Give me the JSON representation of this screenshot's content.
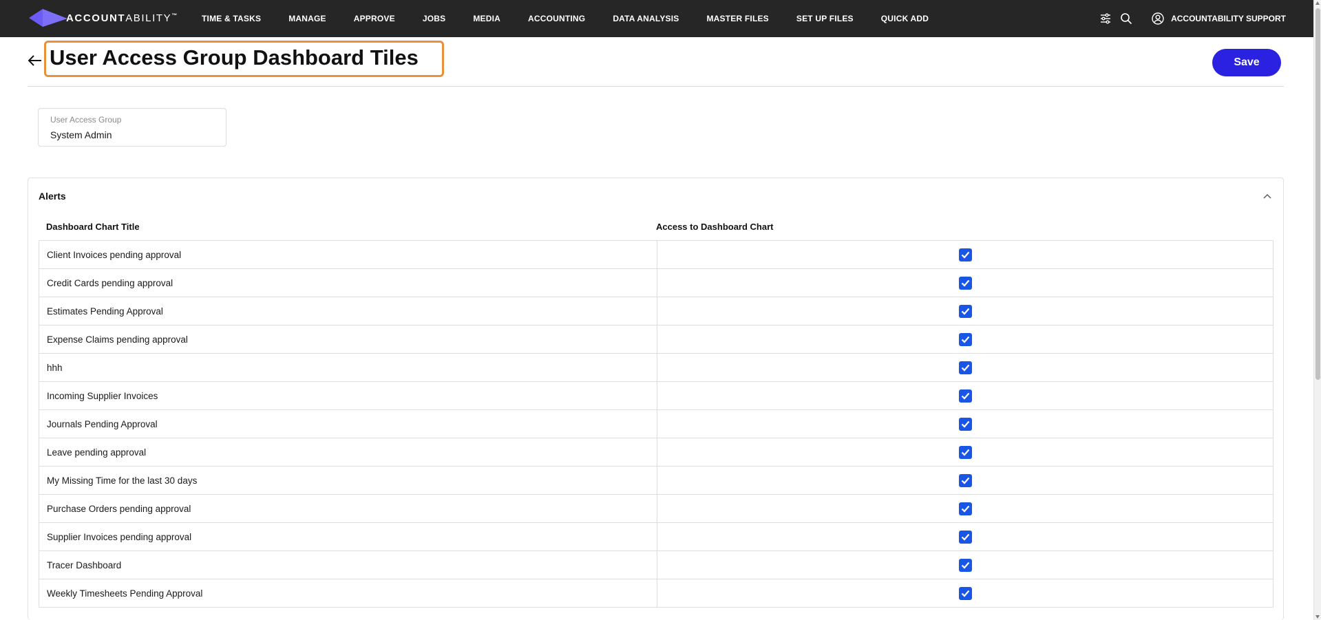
{
  "brand": {
    "name_bold": "ACCOUNT",
    "name_thin": "ABILITY",
    "tm": "™",
    "accent": "#6b5cf5"
  },
  "nav": {
    "items": [
      "TIME & TASKS",
      "MANAGE",
      "APPROVE",
      "JOBS",
      "MEDIA",
      "ACCOUNTING",
      "DATA ANALYSIS",
      "MASTER FILES",
      "SET UP FILES",
      "QUICK ADD"
    ],
    "icons": [
      "sliders-icon",
      "search-icon",
      "user-circle-icon"
    ],
    "user_label": "ACCOUNTABILITY SUPPORT"
  },
  "header": {
    "title": "User Access Group Dashboard Tiles",
    "save_label": "Save",
    "save_color": "#2a22e0"
  },
  "field": {
    "label": "User Access Group",
    "value": "System Admin"
  },
  "section": {
    "title": "Alerts",
    "columns": [
      "Dashboard Chart Title",
      "Access to Dashboard Chart"
    ],
    "rows": [
      {
        "title": "Client Invoices pending approval",
        "access": true
      },
      {
        "title": "Credit Cards pending approval",
        "access": true
      },
      {
        "title": "Estimates Pending Approval",
        "access": true
      },
      {
        "title": "Expense Claims pending approval",
        "access": true
      },
      {
        "title": "hhh",
        "access": true
      },
      {
        "title": "Incoming Supplier Invoices",
        "access": true
      },
      {
        "title": "Journals Pending Approval",
        "access": true
      },
      {
        "title": "Leave pending approval",
        "access": true
      },
      {
        "title": "My Missing Time for the last 30 days",
        "access": true
      },
      {
        "title": "Purchase Orders pending approval",
        "access": true
      },
      {
        "title": "Supplier Invoices pending approval",
        "access": true
      },
      {
        "title": "Tracer Dashboard",
        "access": true
      },
      {
        "title": "Weekly Timesheets Pending Approval",
        "access": true
      }
    ]
  },
  "colors": {
    "topbar": "#262626",
    "checkbox": "#1a56e6",
    "title_highlight": "#e8913a"
  }
}
